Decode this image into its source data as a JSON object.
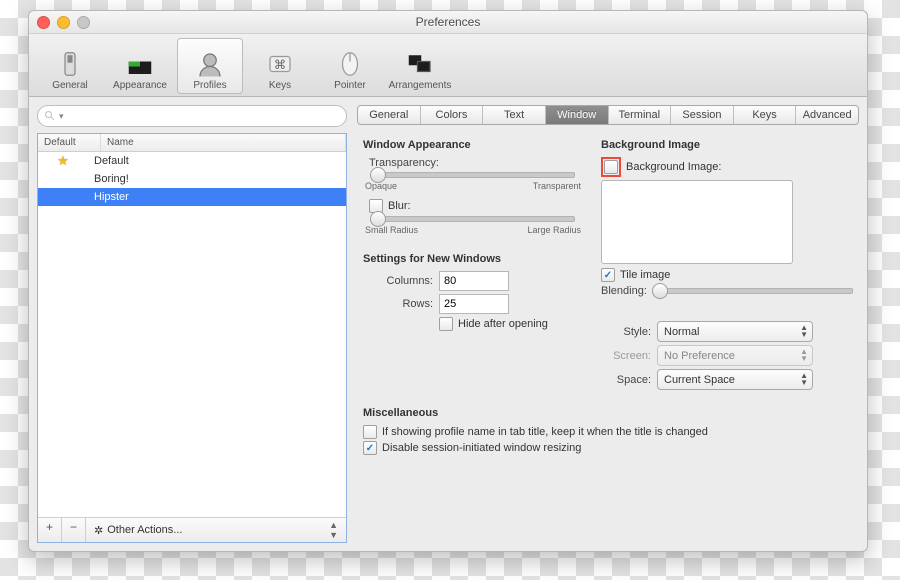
{
  "title": "Preferences",
  "toolbar": [
    {
      "label": "General"
    },
    {
      "label": "Appearance"
    },
    {
      "label": "Profiles",
      "selected": true
    },
    {
      "label": "Keys"
    },
    {
      "label": "Pointer"
    },
    {
      "label": "Arrangements"
    }
  ],
  "profiles": {
    "columns": {
      "default": "Default",
      "name": "Name"
    },
    "rows": [
      {
        "default": true,
        "name": "Default"
      },
      {
        "default": false,
        "name": "Boring!"
      },
      {
        "default": false,
        "name": "Hipster",
        "selected": true
      }
    ],
    "footer": {
      "add": "+",
      "remove": "−",
      "other": "Other Actions..."
    }
  },
  "tabs": [
    "General",
    "Colors",
    "Text",
    "Window",
    "Terminal",
    "Session",
    "Keys",
    "Advanced"
  ],
  "active_tab": "Window",
  "window_appearance": {
    "heading": "Window Appearance",
    "transparency": {
      "label": "Transparency:",
      "low": "Opaque",
      "high": "Transparent"
    },
    "blur": {
      "label": "Blur:",
      "low": "Small Radius",
      "high": "Large Radius",
      "checked": false
    }
  },
  "bg_image": {
    "heading": "Background Image",
    "checkbox": "Background Image:",
    "tile": "Tile image",
    "tile_checked": true,
    "blending": "Blending:"
  },
  "new_windows": {
    "heading": "Settings for New Windows",
    "columns": {
      "label": "Columns:",
      "value": "80"
    },
    "rows": {
      "label": "Rows:",
      "value": "25"
    },
    "hide": "Hide after opening",
    "hide_checked": false
  },
  "style": {
    "label": "Style:",
    "value": "Normal"
  },
  "screen": {
    "label": "Screen:",
    "value": "No Preference"
  },
  "space": {
    "label": "Space:",
    "value": "Current Space"
  },
  "misc": {
    "heading": "Miscellaneous",
    "keep_title": "If showing profile name in tab title, keep it when the title is changed",
    "keep_title_checked": false,
    "disable_resize": "Disable session-initiated window resizing",
    "disable_resize_checked": true
  }
}
